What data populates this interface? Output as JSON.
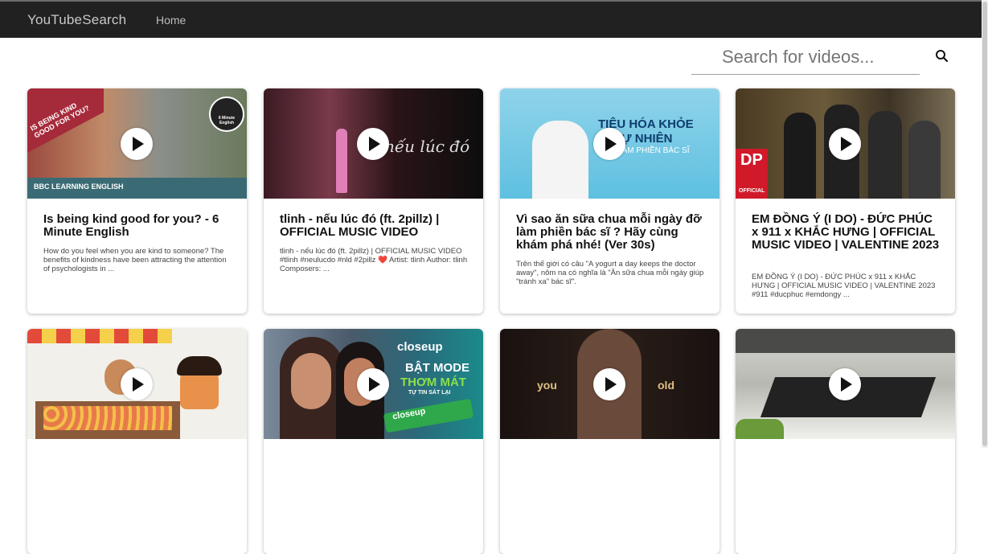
{
  "navbar": {
    "brand": "YouTubeSearch",
    "home": "Home"
  },
  "search": {
    "placeholder": "Search for videos...",
    "icon": "search-icon"
  },
  "cards": [
    {
      "title": "Is being kind good for you? - 6 Minute English",
      "description": "How do you feel when you are kind to someone? The benefits of kindness have been attracting the attention of psychologists in ...",
      "thumb_text": [
        "IS BEING KIND GOOD FOR YOU?",
        "BBC LEARNING ENGLISH",
        "6 Minute English"
      ]
    },
    {
      "title": "tlinh - nếu lúc đó (ft. 2pillz) | OFFICIAL MUSIC VIDEO",
      "description": "tlinh - nếu lúc đó (ft. 2pillz) | OFFICIAL MUSIC VIDEO #tlinh #neulucdo #nld #2pillz ❤️ Artist: tlinh Author: tlinh Composers: ...",
      "thumb_text": [
        "nếu lúc đó"
      ]
    },
    {
      "title": "Vì sao ăn sữa chua mỗi ngày đỡ làm phiền bác sĩ ? Hãy cùng khám phá nhé! (Ver 30s)",
      "description": "Trên thế giới có câu \"A yogurt a day keeps the doctor away\", nôm na có nghĩa là \"Ăn sữa chua mỗi ngày giúp \"tránh xa\" bác sĩ\".",
      "thumb_text": [
        "TIÊU HÓA KHỎE",
        "TỰ NHIÊN",
        "LÀM PHIỀN BÁC SĨ"
      ]
    },
    {
      "title": "EM ĐỒNG Ý (I DO) - ĐỨC PHÚC x 911 x KHẮC HƯNG | OFFICIAL MUSIC VIDEO | VALENTINE 2023",
      "description": "EM ĐỒNG Ý (I DO) - ĐỨC PHÚC x 911 x KHẮC HƯNG | OFFICIAL MUSIC VIDEO | VALENTINE 2023 #911 #ducphuc #emdongy ...",
      "thumb_text": [
        "DP",
        "OFFICIAL"
      ]
    },
    {
      "title": "",
      "description": "",
      "thumb_text": []
    },
    {
      "title": "",
      "description": "",
      "thumb_text": [
        "closeup",
        "BẬT MODE",
        "THƠM MÁT",
        "TỰ TIN SÁT LẠI",
        "closeup"
      ]
    },
    {
      "title": "",
      "description": "",
      "thumb_text": [
        "you",
        "old"
      ]
    },
    {
      "title": "",
      "description": "",
      "thumb_text": []
    }
  ]
}
